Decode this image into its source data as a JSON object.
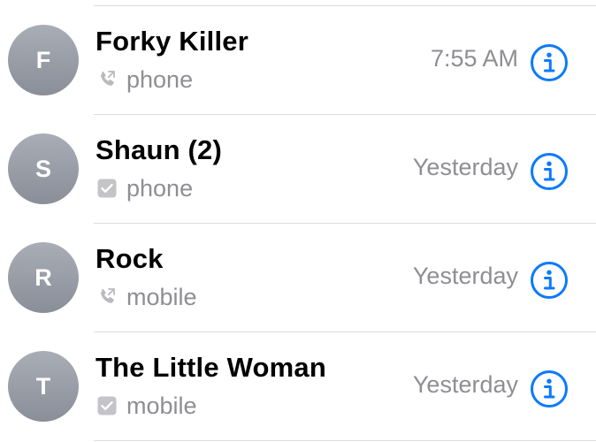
{
  "calls": [
    {
      "initial": "F",
      "name": "Forky Killer",
      "type": "phone",
      "type_icon": "outgoing-call-icon",
      "time": "7:55 AM"
    },
    {
      "initial": "S",
      "name": "Shaun (2)",
      "type": "phone",
      "type_icon": "checkbox-icon",
      "time": "Yesterday"
    },
    {
      "initial": "R",
      "name": "Rock",
      "type": "mobile",
      "type_icon": "outgoing-call-icon",
      "time": "Yesterday"
    },
    {
      "initial": "T",
      "name": "The Little Woman",
      "type": "mobile",
      "type_icon": "checkbox-icon",
      "time": "Yesterday"
    }
  ],
  "colors": {
    "accent": "#0a7aff",
    "secondary_text": "#8e8e93",
    "separator": "#dcdce0",
    "avatar": "#9a9ea8"
  }
}
